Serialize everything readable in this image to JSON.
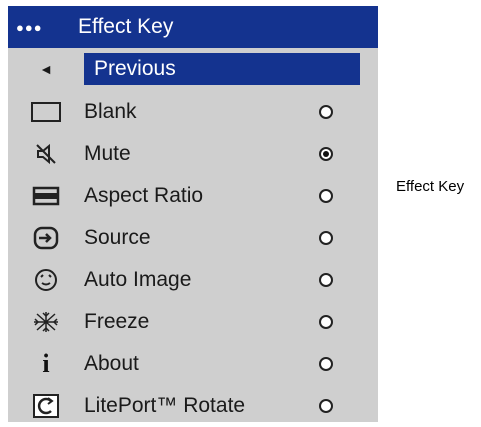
{
  "menu": {
    "title": "Effect Key",
    "title_dots": "●●●",
    "previous": {
      "arrow": "◄",
      "label": "Previous"
    },
    "options": [
      {
        "label": "Blank",
        "icon": "blank-screen-icon",
        "selected": false
      },
      {
        "label": "Mute",
        "icon": "mute-icon",
        "selected": true
      },
      {
        "label": "Aspect Ratio",
        "icon": "aspect-ratio-icon",
        "selected": false
      },
      {
        "label": "Source",
        "icon": "source-icon",
        "selected": false
      },
      {
        "label": "Auto Image",
        "icon": "auto-image-icon",
        "selected": false
      },
      {
        "label": "Freeze",
        "icon": "freeze-icon",
        "selected": false
      },
      {
        "label": "About",
        "icon": "about-icon",
        "selected": false
      },
      {
        "label": "LitePort™ Rotate",
        "icon": "rotate-icon",
        "selected": false
      }
    ]
  },
  "side_label": "Effect Key",
  "colors": {
    "highlight": "#14338f",
    "menu_bg": "#cfcfcf"
  }
}
